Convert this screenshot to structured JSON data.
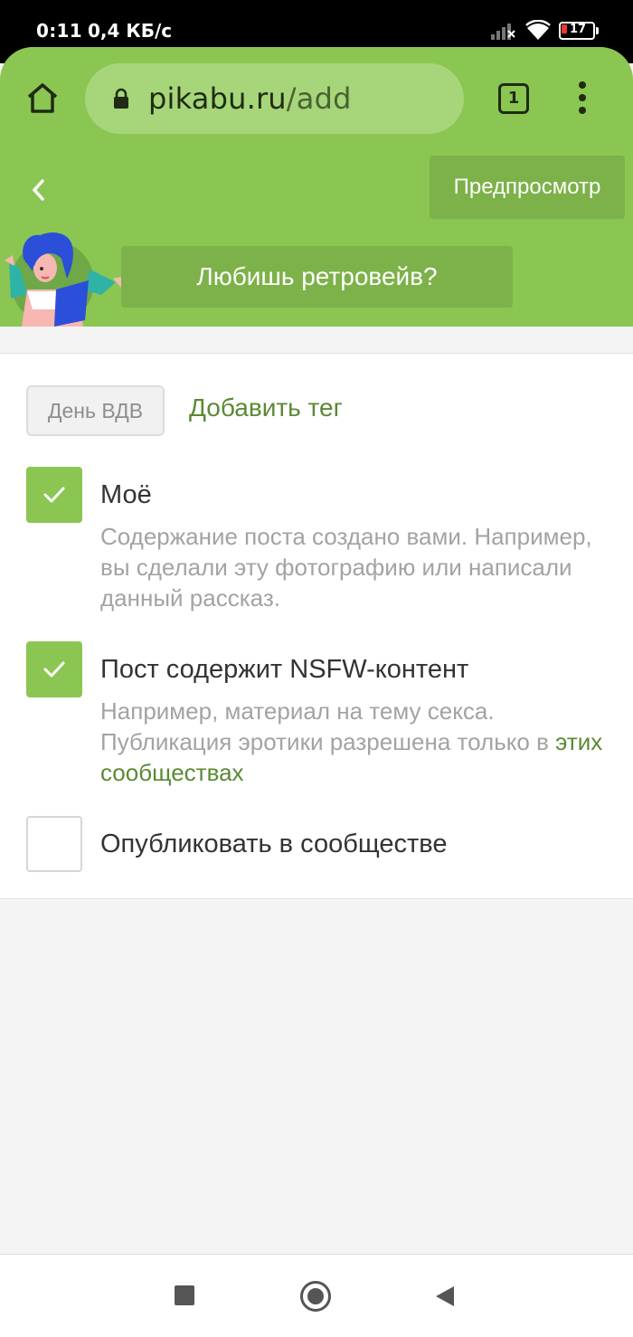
{
  "status_bar": {
    "time": "0:11",
    "speed": "0,4 КБ/с",
    "battery": "17"
  },
  "browser": {
    "url_host": "pikabu.ru",
    "url_path": "/add",
    "tab_count": "1"
  },
  "header": {
    "preview_label": "Предпросмотр",
    "promo_label": "Любишь ретровейв?"
  },
  "tags": {
    "existing_tag": "День ВДВ",
    "add_tag_label": "Добавить тег"
  },
  "options": {
    "mine": {
      "title": "Моё",
      "description": "Содержание поста создано вами. Например, вы сделали эту фотографию или написали данный рассказ.",
      "checked": true
    },
    "nsfw": {
      "title": "Пост содержит NSFW-контент",
      "description_before": "Например, материал на тему секса. Публикация эротики разрешена только в ",
      "description_link": "этих сообществах",
      "checked": true
    },
    "community": {
      "title": "Опубликовать в сообществе",
      "checked": false
    }
  },
  "colors": {
    "brand_green": "#8bc652",
    "dark_green": "#7cb249",
    "link_green": "#5b8a32"
  }
}
